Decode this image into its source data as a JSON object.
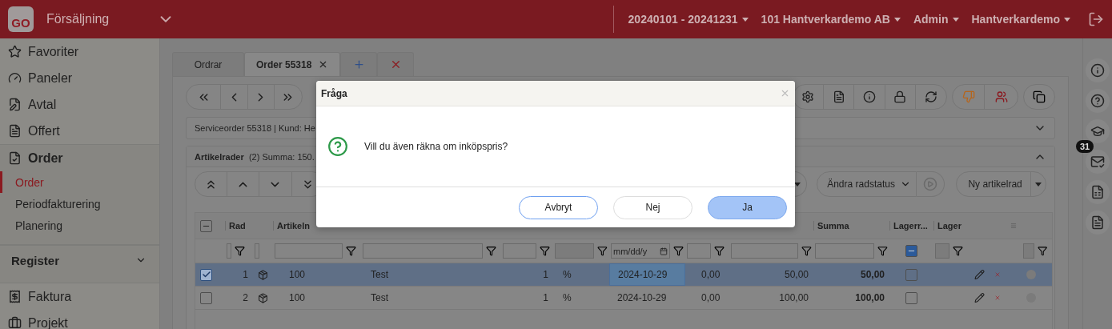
{
  "header": {
    "logo": "GO",
    "module": "Försäljning",
    "menus": [
      {
        "label": "20240101 - 20241231"
      },
      {
        "label": "101 Hantverkardemo AB"
      },
      {
        "label": "Admin"
      },
      {
        "label": "Hantverkardemo"
      }
    ]
  },
  "sidebar": [
    {
      "label": "Favoriter",
      "kind": "link"
    },
    {
      "label": "Paneler",
      "kind": "link"
    },
    {
      "label": "Avtal",
      "kind": "link"
    },
    {
      "label": "Offert",
      "kind": "link"
    },
    {
      "label": "Order",
      "kind": "group",
      "expanded": true,
      "children": [
        {
          "label": "Order",
          "selected": true
        },
        {
          "label": "Periodfakturering",
          "selected": false
        },
        {
          "label": "Planering",
          "selected": false
        }
      ]
    },
    {
      "label": "Register",
      "kind": "section",
      "expanded": false
    },
    {
      "label": "Faktura",
      "kind": "link"
    },
    {
      "label": "Projekt",
      "kind": "link"
    }
  ],
  "tabs": [
    {
      "kind": "text",
      "label": "Ordrar",
      "selected": false,
      "closable": false
    },
    {
      "kind": "text",
      "label": "Order 55318",
      "selected": true,
      "closable": true
    },
    {
      "kind": "add",
      "selected": false
    },
    {
      "kind": "close-all",
      "selected": false
    }
  ],
  "info_bar": {
    "text": "Serviceorder 55318 | Kund: He",
    "expanded": false
  },
  "section": {
    "title": "Artikelrader",
    "summary": "(2) Summa: 150.",
    "expanded": true
  },
  "row_toolbar": {
    "status_select": "Ändra radstatus",
    "new_row": "Ny artikelrad"
  },
  "table": {
    "select_all_partial": true,
    "columns": [
      {
        "label": "Rad"
      },
      {
        "label": "Artikeln"
      },
      {
        "label": "Summa"
      },
      {
        "label": "Lagerr..."
      },
      {
        "label": "Lager"
      }
    ],
    "filters": {
      "date_placeholder": "mm/dd/y",
      "stock_filter_partial": true
    },
    "rows": [
      {
        "selected": true,
        "checked": true,
        "rad": "1",
        "artikeln": "100",
        "column_4": "Test",
        "column_5": "1",
        "column_6": "%",
        "column_7": "2024-10-29",
        "column_8": "0,00",
        "column_9": "50,00",
        "summa": "50,00",
        "lagerr": false
      },
      {
        "selected": false,
        "checked": false,
        "rad": "2",
        "artikeln": "100",
        "column_4": "Test",
        "column_5": "1",
        "column_6": "%",
        "column_7": "2024-10-29",
        "column_8": "0,00",
        "column_9": "100,00",
        "summa": "100,00",
        "lagerr": false
      }
    ]
  },
  "right_rail": {
    "badge": "31"
  },
  "dialog": {
    "title": "Fråga",
    "message": "Vill du även räkna om inköpspris?",
    "buttons": [
      {
        "label": "Avbryt",
        "kind": "outline"
      },
      {
        "label": "Nej",
        "kind": "plain"
      },
      {
        "label": "Ja",
        "kind": "primary"
      }
    ]
  }
}
